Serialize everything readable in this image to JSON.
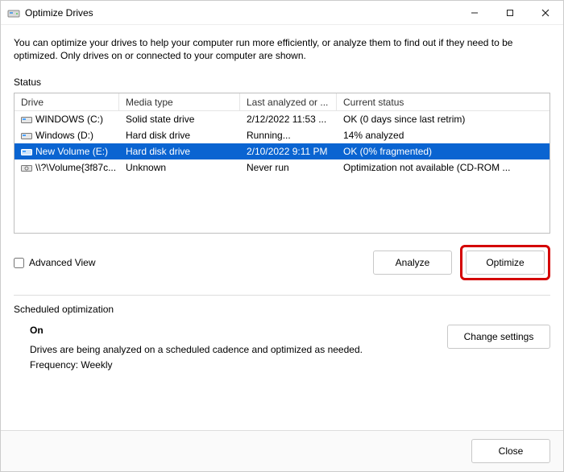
{
  "window": {
    "title": "Optimize Drives"
  },
  "description": "You can optimize your drives to help your computer run more efficiently, or analyze them to find out if they need to be optimized. Only drives on or connected to your computer are shown.",
  "status_label": "Status",
  "columns": {
    "drive": "Drive",
    "media": "Media type",
    "last": "Last analyzed or ...",
    "status": "Current status"
  },
  "drives": [
    {
      "name": "WINDOWS (C:)",
      "media": "Solid state drive",
      "last": "2/12/2022 11:53 ...",
      "status": "OK (0 days since last retrim)",
      "selected": false,
      "icon": "ssd"
    },
    {
      "name": "Windows (D:)",
      "media": "Hard disk drive",
      "last": "Running...",
      "status": "14% analyzed",
      "selected": false,
      "icon": "hdd"
    },
    {
      "name": "New Volume (E:)",
      "media": "Hard disk drive",
      "last": "2/10/2022 9:11 PM",
      "status": "OK (0% fragmented)",
      "selected": true,
      "icon": "hdd"
    },
    {
      "name": "\\\\?\\Volume{3f87c...",
      "media": "Unknown",
      "last": "Never run",
      "status": "Optimization not available (CD-ROM ...",
      "selected": false,
      "icon": "cd"
    }
  ],
  "advanced_view_label": "Advanced View",
  "buttons": {
    "analyze": "Analyze",
    "optimize": "Optimize",
    "change": "Change settings",
    "close": "Close"
  },
  "schedule": {
    "section_label": "Scheduled optimization",
    "state": "On",
    "desc": "Drives are being analyzed on a scheduled cadence and optimized as needed.",
    "freq": "Frequency: Weekly"
  }
}
